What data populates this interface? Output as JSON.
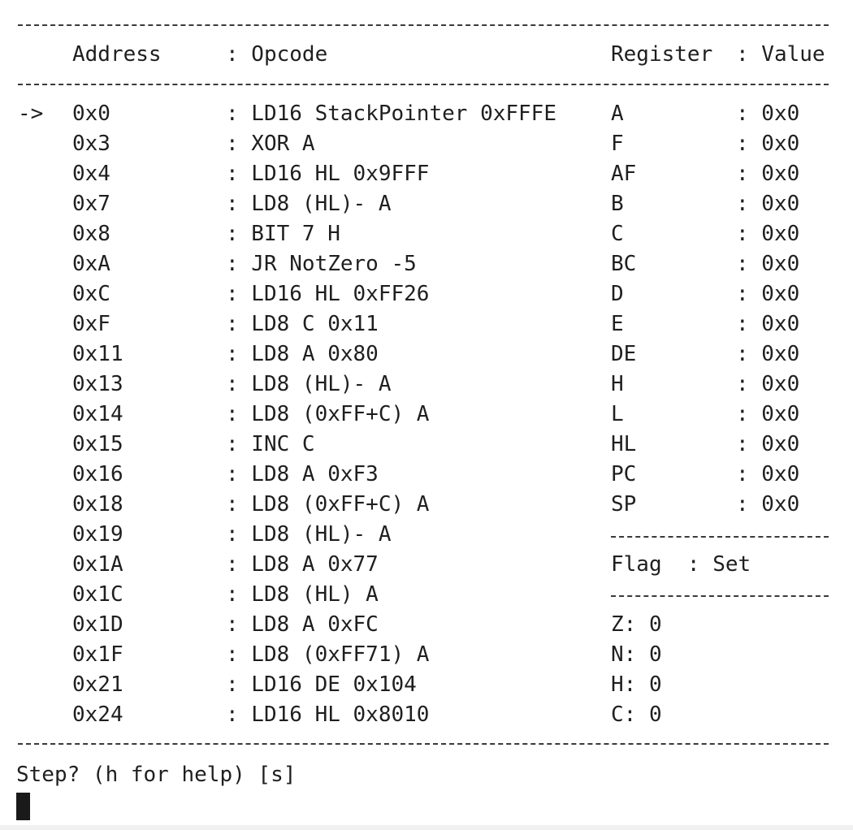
{
  "header": {
    "address": "Address",
    "opcode": ": Opcode",
    "register": "Register",
    "value": ": Value"
  },
  "current_marker": "->",
  "instructions": [
    {
      "address": "0x0",
      "opcode": ": LD16 StackPointer 0xFFFE"
    },
    {
      "address": "0x3",
      "opcode": ": XOR A"
    },
    {
      "address": "0x4",
      "opcode": ": LD16 HL 0x9FFF"
    },
    {
      "address": "0x7",
      "opcode": ": LD8 (HL)- A"
    },
    {
      "address": "0x8",
      "opcode": ": BIT 7 H"
    },
    {
      "address": "0xA",
      "opcode": ": JR NotZero -5"
    },
    {
      "address": "0xC",
      "opcode": ": LD16 HL 0xFF26"
    },
    {
      "address": "0xF",
      "opcode": ": LD8 C 0x11"
    },
    {
      "address": "0x11",
      "opcode": ": LD8 A 0x80"
    },
    {
      "address": "0x13",
      "opcode": ": LD8 (HL)- A"
    },
    {
      "address": "0x14",
      "opcode": ": LD8 (0xFF+C) A"
    },
    {
      "address": "0x15",
      "opcode": ": INC C"
    },
    {
      "address": "0x16",
      "opcode": ": LD8 A 0xF3"
    },
    {
      "address": "0x18",
      "opcode": ": LD8 (0xFF+C) A"
    },
    {
      "address": "0x19",
      "opcode": ": LD8 (HL)- A"
    },
    {
      "address": "0x1A",
      "opcode": ": LD8 A 0x77"
    },
    {
      "address": "0x1C",
      "opcode": ": LD8 (HL) A"
    },
    {
      "address": "0x1D",
      "opcode": ": LD8 A 0xFC"
    },
    {
      "address": "0x1F",
      "opcode": ": LD8 (0xFF71) A"
    },
    {
      "address": "0x21",
      "opcode": ": LD16 DE 0x104"
    },
    {
      "address": "0x24",
      "opcode": ": LD16 HL 0x8010"
    }
  ],
  "registers": [
    {
      "name": "A",
      "value": ": 0x0"
    },
    {
      "name": "F",
      "value": ": 0x0"
    },
    {
      "name": "AF",
      "value": ": 0x0"
    },
    {
      "name": "B",
      "value": ": 0x0"
    },
    {
      "name": "C",
      "value": ": 0x0"
    },
    {
      "name": "BC",
      "value": ": 0x0"
    },
    {
      "name": "D",
      "value": ": 0x0"
    },
    {
      "name": "E",
      "value": ": 0x0"
    },
    {
      "name": "DE",
      "value": ": 0x0"
    },
    {
      "name": "H",
      "value": ": 0x0"
    },
    {
      "name": "L",
      "value": ": 0x0"
    },
    {
      "name": "HL",
      "value": ": 0x0"
    },
    {
      "name": "PC",
      "value": ": 0x0"
    },
    {
      "name": "SP",
      "value": ": 0x0"
    }
  ],
  "flags_header": "Flag  : Set",
  "flags": [
    {
      "label": "Z: 0"
    },
    {
      "label": "N: 0"
    },
    {
      "label": "H: 0"
    },
    {
      "label": "C: 0"
    }
  ],
  "prompt": "Step? (h for help) [s]"
}
